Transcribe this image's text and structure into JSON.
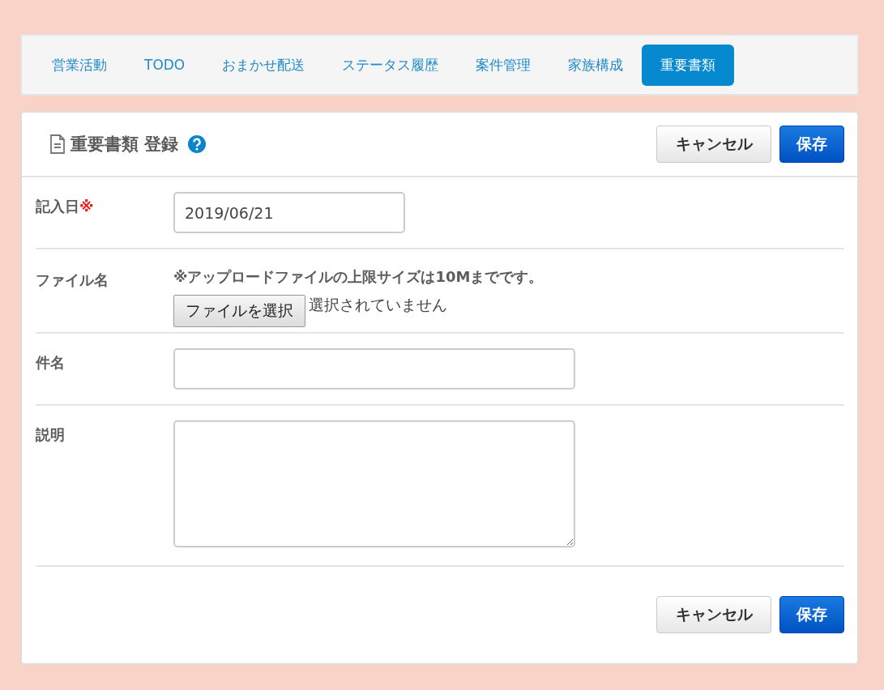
{
  "tabs": [
    {
      "label": "営業活動",
      "selected": false
    },
    {
      "label": "TODO",
      "selected": false
    },
    {
      "label": "おまかせ配送",
      "selected": false
    },
    {
      "label": "ステータス履歴",
      "selected": false
    },
    {
      "label": "案件管理",
      "selected": false
    },
    {
      "label": "家族構成",
      "selected": false
    },
    {
      "label": "重要書類",
      "selected": true
    }
  ],
  "panel": {
    "title": "重要書類 登録",
    "header_buttons": [
      {
        "kind": "cancel",
        "label": "キャンセル"
      },
      {
        "kind": "save",
        "label": "保存"
      }
    ],
    "fields": [
      {
        "kind": "date",
        "label": "記入日",
        "required_mark": "※",
        "value": "2019/06/21"
      },
      {
        "kind": "file",
        "label": "ファイル名",
        "note": "※アップロードファイルの上限サイズは10Mまでです。",
        "button": "ファイルを選択",
        "status": "選択されていません"
      },
      {
        "kind": "text",
        "label": "件名"
      },
      {
        "kind": "textarea",
        "label": "説明"
      }
    ],
    "footer_buttons": [
      {
        "kind": "cancel",
        "label": "キャンセル"
      },
      {
        "kind": "save",
        "label": "保存"
      }
    ]
  }
}
